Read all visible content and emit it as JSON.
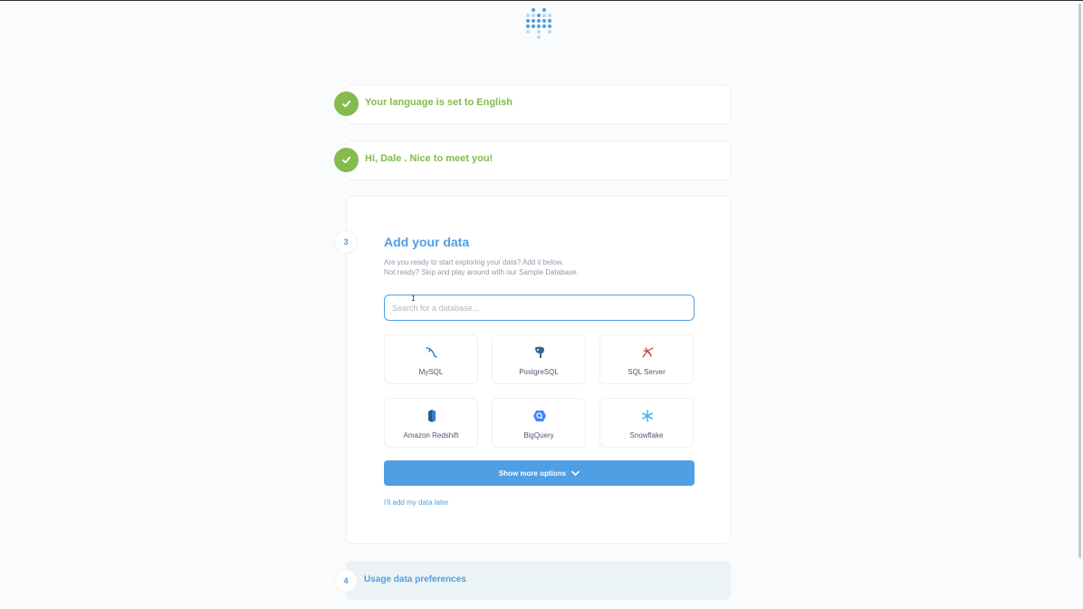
{
  "steps": {
    "language": {
      "label": "Your language is set to English"
    },
    "user": {
      "label": "Hi, Dale . Nice to meet you!"
    },
    "add_data": {
      "number": "3",
      "title": "Add your data",
      "description_line1": "Are you ready to start exploring your data? Add it below.",
      "description_line2": "Not ready? Skip and play around with our Sample Database.",
      "search_placeholder": "Search for a database...",
      "databases": [
        {
          "name": "MySQL",
          "icon": "mysql-dolphin-icon"
        },
        {
          "name": "PostgreSQL",
          "icon": "postgresql-elephant-icon"
        },
        {
          "name": "SQL Server",
          "icon": "sql-server-icon"
        },
        {
          "name": "Amazon Redshift",
          "icon": "redshift-icon"
        },
        {
          "name": "BigQuery",
          "icon": "bigquery-icon"
        },
        {
          "name": "Snowflake",
          "icon": "snowflake-icon"
        }
      ],
      "show_more_label": "Show more options",
      "add_later_label": "I'll add my data later"
    },
    "usage": {
      "number": "4",
      "label": "Usage data preferences"
    }
  },
  "colors": {
    "brand": "#509ee3",
    "success": "#84bb4c",
    "text": "#4c5773",
    "muted": "#949aab"
  }
}
